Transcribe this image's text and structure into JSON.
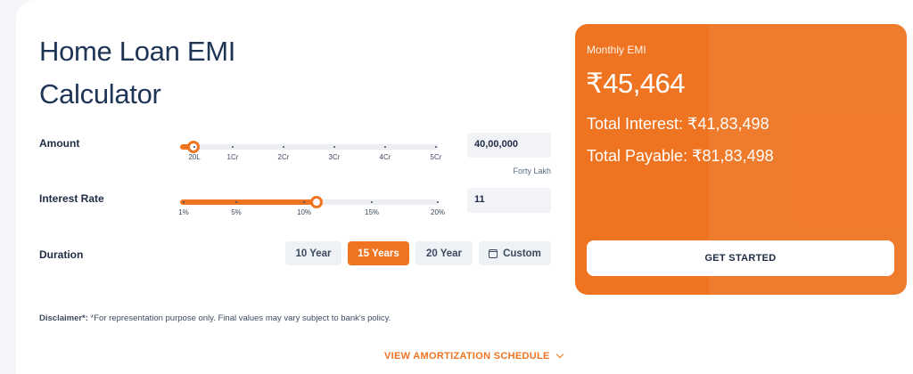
{
  "title": "Home Loan EMI Calculator",
  "amount": {
    "label": "Amount",
    "value": "40,00,000",
    "words": "Forty Lakh",
    "slider_fraction": 0.052,
    "ticks": [
      "20L",
      "1Cr",
      "2Cr",
      "3Cr",
      "4Cr",
      "5Cr"
    ]
  },
  "interest": {
    "label": "Interest Rate",
    "value": "11",
    "slider_fraction": 0.526,
    "ticks": [
      "1%",
      "5%",
      "10%",
      "15%",
      "20%"
    ]
  },
  "duration": {
    "label": "Duration",
    "options": [
      "10 Year",
      "15 Years",
      "20 Year"
    ],
    "selected": "15 Years",
    "custom_label": "Custom"
  },
  "result": {
    "emi_label": "Monthly EMI",
    "emi_value": "₹45,464",
    "total_interest": "Total Interest: ₹41,83,498",
    "total_payable": "Total Payable: ₹81,83,498",
    "cta": "GET STARTED"
  },
  "disclaimer": {
    "prefix": "Disclaimer*:",
    "text": " *For representation purpose only. Final values may vary subject to bank's policy."
  },
  "amortization_link": "VIEW AMORTIZATION SCHEDULE",
  "colors": {
    "accent": "#ef7421",
    "heading": "#1e3556"
  }
}
